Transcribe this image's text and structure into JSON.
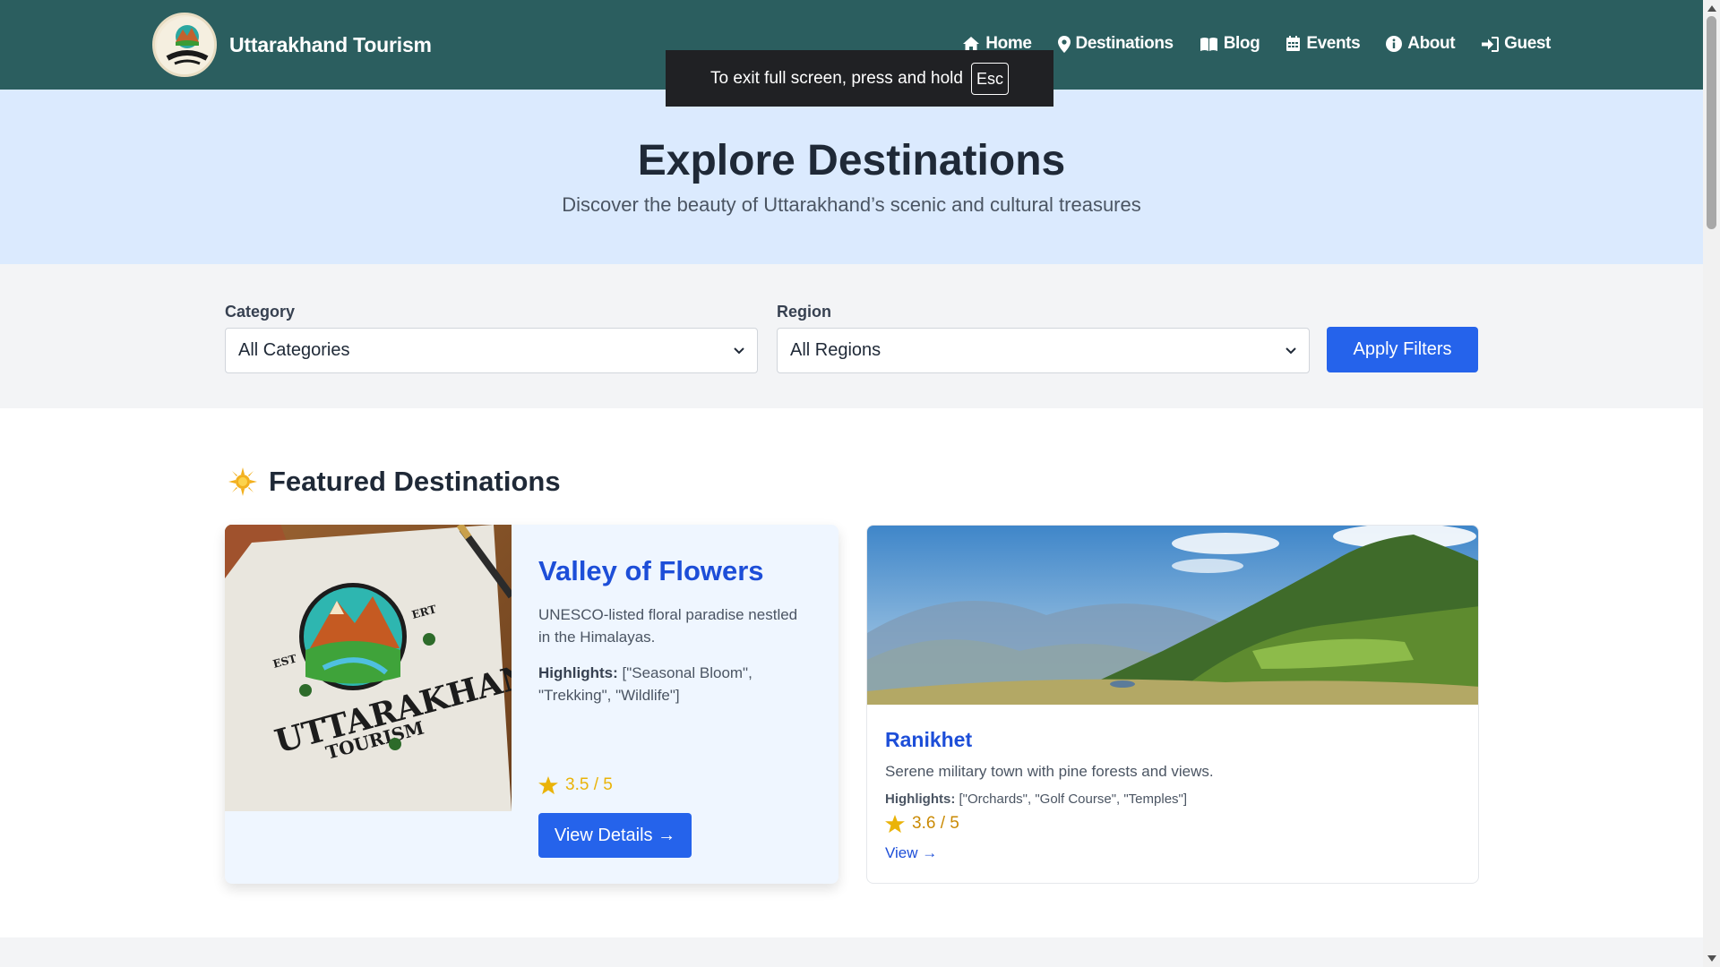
{
  "navbar": {
    "brand_title": "Uttarakhand Tourism",
    "logo_icon": "uttarakhand-tourism-logo",
    "links": [
      {
        "label": "Home",
        "icon": "home-icon"
      },
      {
        "label": "Destinations",
        "icon": "map-pin-icon"
      },
      {
        "label": "Blog",
        "icon": "book-icon"
      },
      {
        "label": "Events",
        "icon": "calendar-icon"
      },
      {
        "label": "About",
        "icon": "info-icon"
      },
      {
        "label": "Guest",
        "icon": "sign-in-icon"
      }
    ]
  },
  "fullscreen_toast": {
    "message": "To exit full screen, press and hold",
    "key": "Esc"
  },
  "hero": {
    "title": "Explore Destinations",
    "subtitle": "Discover the beauty of Uttarakhand’s scenic and cultural treasures"
  },
  "filters": {
    "category_label": "Category",
    "category_value": "All Categories",
    "region_label": "Region",
    "region_value": "All Regions",
    "apply_label": "Apply Filters"
  },
  "featured": {
    "heading": "Featured Destinations",
    "heading_icon": "sparkle-icon",
    "main_card": {
      "title": "Valley of Flowers",
      "description": "UNESCO-listed floral paradise nestled in the Himalayas.",
      "highlights_label": "Highlights:",
      "highlights_value": "[\"Seasonal Bloom\", \"Trekking\", \"Wildlife\"]",
      "rating": "3.5 / 5",
      "button_label": "View Details →",
      "image_logo_text": [
        "EST",
        "ERT",
        "UTTARAKHAND",
        "TOURISM"
      ]
    },
    "side_card": {
      "title": "Ranikhet",
      "description": "Serene military town with pine forests and views.",
      "highlights_label": "Highlights:",
      "highlights_value": "[\"Orchards\", \"Golf Course\", \"Temples\"]",
      "rating": "3.6 / 5",
      "link_label": "View →"
    }
  },
  "colors": {
    "navbar": "#2b5e5f",
    "hero_bg": "#dbeafe",
    "filters_bg": "#f3f4f6",
    "primary": "#2563eb",
    "link": "#1d4ed8",
    "star": "#eab308"
  }
}
